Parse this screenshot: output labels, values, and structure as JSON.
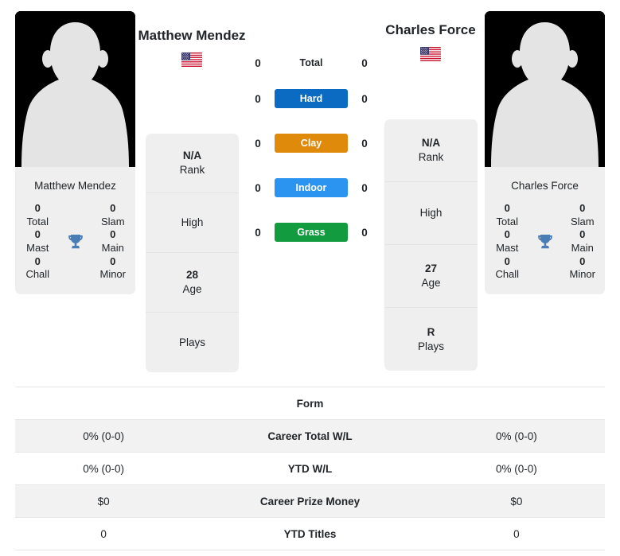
{
  "players": {
    "left": {
      "heading": "Matthew Mendez",
      "card_name": "Matthew Mendez",
      "flag": "us-flag-icon",
      "titles": [
        {
          "num": "0",
          "label": "Total"
        },
        {
          "num": "0",
          "label": "Slam"
        },
        {
          "num": "0",
          "label": "Mast"
        },
        {
          "num": "0",
          "label": "Main"
        },
        {
          "num": "0",
          "label": "Chall"
        },
        {
          "num": "0",
          "label": "Minor"
        }
      ],
      "info": [
        {
          "value": "N/A",
          "label": "Rank"
        },
        {
          "value": "",
          "label": "High"
        },
        {
          "value": "28",
          "label": "Age"
        },
        {
          "value": "",
          "label": "Plays"
        }
      ]
    },
    "right": {
      "heading": "Charles Force",
      "card_name": "Charles Force",
      "flag": "us-flag-icon",
      "titles": [
        {
          "num": "0",
          "label": "Total"
        },
        {
          "num": "0",
          "label": "Slam"
        },
        {
          "num": "0",
          "label": "Mast"
        },
        {
          "num": "0",
          "label": "Main"
        },
        {
          "num": "0",
          "label": "Chall"
        },
        {
          "num": "0",
          "label": "Minor"
        }
      ],
      "info": [
        {
          "value": "N/A",
          "label": "Rank"
        },
        {
          "value": "",
          "label": "High"
        },
        {
          "value": "27",
          "label": "Age"
        },
        {
          "value": "R",
          "label": "Plays"
        }
      ]
    }
  },
  "trophy_icon": "trophy-icon",
  "trophy_color": "#4a7cb5",
  "surfaces": [
    {
      "label": "Total",
      "left": "0",
      "right": "0",
      "color": "",
      "plain": true
    },
    {
      "label": "Hard",
      "left": "0",
      "right": "0",
      "color": "#0b6bc2",
      "plain": false
    },
    {
      "label": "Clay",
      "left": "0",
      "right": "0",
      "color": "#e08a0c",
      "plain": false
    },
    {
      "label": "Indoor",
      "left": "0",
      "right": "0",
      "color": "#2b93f0",
      "plain": false
    },
    {
      "label": "Grass",
      "left": "0",
      "right": "0",
      "color": "#139b3f",
      "plain": false
    }
  ],
  "form": {
    "title": "Form",
    "rows": [
      {
        "left": "0% (0-0)",
        "label": "Career Total W/L",
        "right": "0% (0-0)"
      },
      {
        "left": "0% (0-0)",
        "label": "YTD W/L",
        "right": "0% (0-0)"
      },
      {
        "left": "$0",
        "label": "Career Prize Money",
        "right": "$0"
      },
      {
        "left": "0",
        "label": "YTD Titles",
        "right": "0"
      }
    ]
  }
}
